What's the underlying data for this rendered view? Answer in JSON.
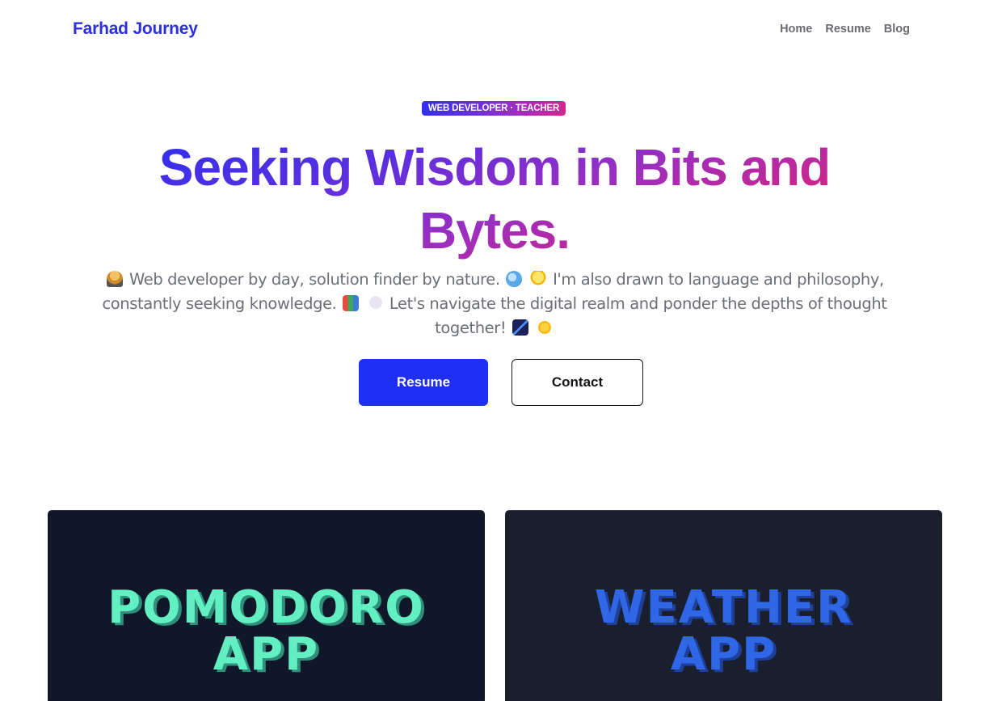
{
  "nav": {
    "brand": "Farhad Journey",
    "links": [
      "Home",
      "Resume",
      "Blog"
    ]
  },
  "hero": {
    "badge": "WEB DEVELOPER · TEACHER",
    "headline": "Seeking Wisdom in Bits and Bytes.",
    "intro": {
      "part1": "Web developer by day, solution finder by nature.",
      "part2": "I'm also drawn to language and philosophy, constantly seeking knowledge.",
      "part3": "Let's navigate the digital realm and ponder the depths of thought together!"
    },
    "emoji_icons": [
      "technologist",
      "globe",
      "light-bulb",
      "books",
      "thought-balloon",
      "shooting-star",
      "sun"
    ],
    "buttons": {
      "primary": "Resume",
      "secondary": "Contact"
    }
  },
  "projects": [
    {
      "title": "POMODORO\nAPP"
    },
    {
      "title": "WEATHER\nAPP"
    }
  ],
  "colors": {
    "brand": "#2b2fdd",
    "primary_button": "#1f2ff5",
    "gradient_start": "#2a2ff0",
    "gradient_end": "#d0246e",
    "card_1_bg": "#101728",
    "card_2_bg": "#1a1f2d",
    "pomodoro_text": "#62f0c3",
    "weather_text": "#2f67e6"
  }
}
